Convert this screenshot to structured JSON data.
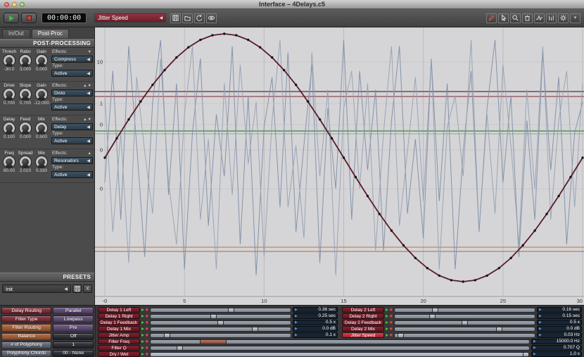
{
  "window": {
    "title": "Interface – 4Delays.c5"
  },
  "ui": {
    "dropdown_arrow": "◀",
    "value_arrow": "▶",
    "menu_caret": "▾"
  },
  "toolbar": {
    "timer": "00:00:00",
    "param_selector": "Jitter Speed",
    "file_icons": [
      "save-icon",
      "folder-icon",
      "undo-icon",
      "eye-icon"
    ],
    "right_icons": [
      "pencil-icon",
      "cursor-icon",
      "magnifier-icon",
      "trash-icon",
      "waveform-icon",
      "levels-icon",
      "gear-icon",
      "menu-caret-icon"
    ]
  },
  "sidebar": {
    "tabs": [
      {
        "label": "In/Out",
        "active": false
      },
      {
        "label": "Post-Proc",
        "active": true
      }
    ],
    "post_processing": {
      "title": "POST-PROCESSING",
      "effects_label": "Effects:",
      "type_label": "Type:",
      "rows": [
        {
          "arrows": "▼",
          "effect": "Compress",
          "type": "Active",
          "knobs": [
            {
              "label": "Thresh",
              "value": "-30.0"
            },
            {
              "label": "Ratio",
              "value": "3.000"
            },
            {
              "label": "Gain",
              "value": "0.000"
            }
          ]
        },
        {
          "arrows": "▲▼",
          "effect": "Disto",
          "type": "Active",
          "knobs": [
            {
              "label": "Drive",
              "value": "0.700"
            },
            {
              "label": "Slope",
              "value": "0.700"
            },
            {
              "label": "Gain",
              "value": "-12.000"
            }
          ]
        },
        {
          "arrows": "▲▼",
          "effect": "Delay",
          "type": "Active",
          "knobs": [
            {
              "label": "Delay",
              "value": "0.100"
            },
            {
              "label": "Feed",
              "value": "0.000"
            },
            {
              "label": "Mix",
              "value": "0.500"
            }
          ]
        },
        {
          "arrows": "▲",
          "effect": "Resonators",
          "type": "Active",
          "knobs": [
            {
              "label": "Freq",
              "value": "80.00"
            },
            {
              "label": "Spread",
              "value": "2.010"
            },
            {
              "label": "Mix",
              "value": "0.330"
            }
          ]
        }
      ]
    },
    "presets": {
      "title": "PRESETS",
      "selected": "Init",
      "close_label": "X"
    }
  },
  "graph": {
    "x_min": 0,
    "x_max": 30,
    "x_ticks": [
      {
        "label": "-0",
        "x": 0
      },
      {
        "label": "5",
        "x": 5
      },
      {
        "label": "10",
        "x": 10
      },
      {
        "label": "15",
        "x": 15
      },
      {
        "label": "20",
        "x": 20
      },
      {
        "label": "25",
        "x": 25
      },
      {
        "label": "30",
        "x": 30
      }
    ],
    "y_ticks": [
      {
        "label": "10",
        "v": 0.773
      },
      {
        "label": "1",
        "v": 0.437
      },
      {
        "label": "0",
        "v": 0.267
      },
      {
        "label": "0",
        "v": 0.062
      },
      {
        "label": "0",
        "v": -0.25
      }
    ],
    "h_lines": [
      {
        "color": "#6d2433",
        "v": 0.534
      },
      {
        "color": "#8a3a4a",
        "v": 0.494
      },
      {
        "color": "#3f7d3f",
        "v": 0.216
      },
      {
        "color": "#9ab89a",
        "v": 0.193
      },
      {
        "color": "#c08050",
        "v": -0.722
      },
      {
        "color": "#b9754a",
        "v": -0.756
      }
    ],
    "sine": {
      "color": "#5c1b29",
      "dot_color": "#141414",
      "x_step": 0.75,
      "values": [
        0,
        0.156,
        0.309,
        0.454,
        0.588,
        0.707,
        0.809,
        0.891,
        0.951,
        0.988,
        1,
        0.988,
        0.951,
        0.891,
        0.809,
        0.707,
        0.588,
        0.454,
        0.309,
        0.156,
        0,
        -0.156,
        -0.309,
        -0.454,
        -0.588,
        -0.707,
        -0.809,
        -0.891,
        -0.951,
        -0.988,
        -1,
        -0.988,
        -0.951,
        -0.891,
        -0.809,
        -0.707,
        -0.588,
        -0.454,
        -0.309,
        -0.156,
        0
      ]
    },
    "jitter": [
      {
        "color": "#7d8ca6",
        "x_step": 0.5,
        "values": [
          -0.2,
          0.7,
          -0.5,
          0.9,
          0.1,
          -0.8,
          0.45,
          0.95,
          -0.3,
          0.6,
          -0.9,
          0.2,
          0.8,
          -0.55,
          0.35,
          -0.15,
          0.9,
          -0.7,
          0.5,
          -0.95,
          0.25,
          0.65,
          -0.4,
          0.85,
          -0.6,
          0.1,
          0.75,
          -0.85,
          0.4,
          -0.25,
          0.95,
          -0.5,
          0.7,
          -0.1,
          0.55,
          -0.75,
          0.3,
          0.9,
          -0.45,
          0.15,
          -0.65,
          0.8,
          -0.35,
          0.6,
          -0.9,
          0.05,
          0.7,
          -0.6,
          0.4,
          0.95,
          -0.2,
          0.5,
          -0.8,
          0.3,
          -0.5,
          0.85,
          -0.1,
          0.65,
          -0.7,
          0.2,
          0.45
        ]
      },
      {
        "color": "#94a0b4",
        "x_step": 0.5,
        "values": [
          0.5,
          -0.6,
          0.2,
          -0.85,
          0.65,
          0.05,
          -0.45,
          0.8,
          -0.2,
          -0.7,
          0.35,
          0.9,
          -0.5,
          0.15,
          -0.9,
          0.6,
          -0.3,
          0.75,
          -0.05,
          0.45,
          -0.8,
          0.3,
          0.95,
          -0.4,
          0.1,
          -0.65,
          0.85,
          -0.15,
          0.55,
          -0.95,
          0.4,
          0.7,
          -0.25,
          0.6,
          -0.75,
          0.2,
          0.9,
          -0.55,
          0.05,
          0.65,
          -0.35,
          0.8,
          -0.9,
          0.25,
          0.5,
          -0.15,
          0.95,
          -0.6,
          0.35,
          -0.45,
          0.75,
          0.1,
          -0.7,
          0.55,
          -0.25,
          0.9,
          -0.5,
          0.3,
          0.7,
          -0.4,
          0.6
        ]
      }
    ]
  },
  "routing_buttons": [
    {
      "name": "Delay Routing",
      "value": "Parallel",
      "name_color": "#7b2330",
      "value_color": "#5a4472"
    },
    {
      "name": "Filter Type",
      "value": "Lowpass",
      "name_color": "#7b2330",
      "value_color": "#5a4472"
    },
    {
      "name": "Filter Routing",
      "value": "Pre",
      "name_color": "#a85a2e",
      "value_color": "#5a4472"
    },
    {
      "name": "Balance",
      "value": "Off",
      "name_color": "#a85a2e",
      "value_color": "#20242c"
    },
    {
      "name": "# of Polyphony",
      "value": "1",
      "name_color": "#5c6472",
      "value_color": "#20242c"
    },
    {
      "name": "Polyphony Chords",
      "value": "00 - None",
      "name_color": "#5c6472",
      "value_color": "#20242c"
    }
  ],
  "slider_pairs": [
    {
      "left": {
        "label": "Delay 1 Left",
        "value": "0.36 sec",
        "pos": 0.58
      },
      "right": {
        "label": "Delay 2 Left",
        "value": "0.16 sec",
        "pos": 0.28
      }
    },
    {
      "left": {
        "label": "Delay 1 Right",
        "value": "0.25 sec",
        "pos": 0.45
      },
      "right": {
        "label": "Delay 2 Right",
        "value": "0.15 sec",
        "pos": 0.26
      }
    },
    {
      "left": {
        "label": "Delay 1 Feedback",
        "value": "0.5 x",
        "pos": 0.5
      },
      "right": {
        "label": "Delay 2 Feedback",
        "value": "0.5 x",
        "pos": 0.5
      }
    },
    {
      "left": {
        "label": "Delay 1 Mix",
        "value": "0.0 dB",
        "pos": 0.76
      },
      "right": {
        "label": "Delay 2 Mix",
        "value": "0.0 dB",
        "pos": 0.76
      }
    },
    {
      "left": {
        "label": "Jitter Amp",
        "value": "0.1 x",
        "pos": 0.1
      },
      "right": {
        "label": "Jitter Speed",
        "value": "0.03 Hz",
        "pos": 0.02,
        "selected": true
      }
    }
  ],
  "slider_full": [
    {
      "label": "Filter Freq",
      "value": "15000.0 Hz",
      "pos": 0.14,
      "handle_w": 38,
      "handle_color": "#a8503a"
    },
    {
      "label": "Filter Q",
      "value": "0.707 Q",
      "pos": 0.07
    },
    {
      "label": "Dry / Wet",
      "value": "1.0 x",
      "pos": 1.0,
      "fill": true
    }
  ]
}
